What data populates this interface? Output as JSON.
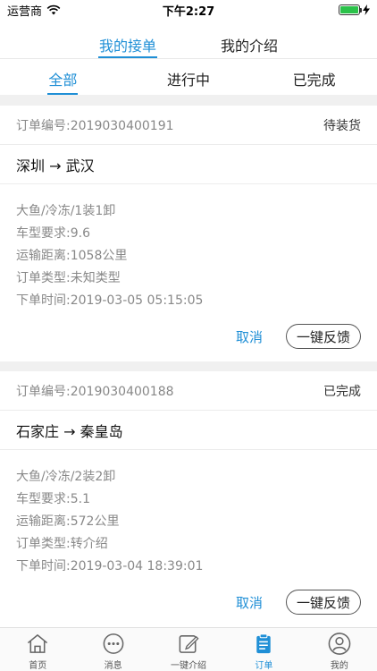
{
  "status_bar": {
    "carrier": "运营商",
    "time": "下午2:27"
  },
  "top_tabs": [
    {
      "label": "我的接单",
      "active": true
    },
    {
      "label": "我的介绍",
      "active": false
    }
  ],
  "filter_tabs": [
    {
      "label": "全部",
      "active": true
    },
    {
      "label": "进行中",
      "active": false
    },
    {
      "label": "已完成",
      "active": false
    }
  ],
  "orders": [
    {
      "order_no": "订单编号:2019030400191",
      "status": "待装货",
      "route": "深圳 → 武汉",
      "details": [
        "大鱼/冷冻/1装1卸",
        "车型要求:9.6",
        "运输距离:1058公里",
        "订单类型:未知类型",
        "下单时间:2019-03-05 05:15:05"
      ],
      "cancel_label": "取消",
      "feedback_label": "一键反馈"
    },
    {
      "order_no": "订单编号:2019030400188",
      "status": "已完成",
      "route": "石家庄 → 秦皇岛",
      "details": [
        "大鱼/冷冻/2装2卸",
        "车型要求:5.1",
        "运输距离:572公里",
        "订单类型:转介绍",
        "下单时间:2019-03-04 18:39:01"
      ],
      "cancel_label": "取消",
      "feedback_label": "一键反馈"
    }
  ],
  "tab_bar": [
    {
      "label": "首页",
      "icon": "home-icon",
      "active": false
    },
    {
      "label": "消息",
      "icon": "message-icon",
      "active": false
    },
    {
      "label": "一键介绍",
      "icon": "edit-icon",
      "active": false
    },
    {
      "label": "订单",
      "icon": "clipboard-icon",
      "active": true
    },
    {
      "label": "我的",
      "icon": "user-icon",
      "active": false
    }
  ],
  "colors": {
    "accent": "#1f8fd6",
    "separator": "#f0f0f0",
    "battery": "#2bc24a"
  }
}
